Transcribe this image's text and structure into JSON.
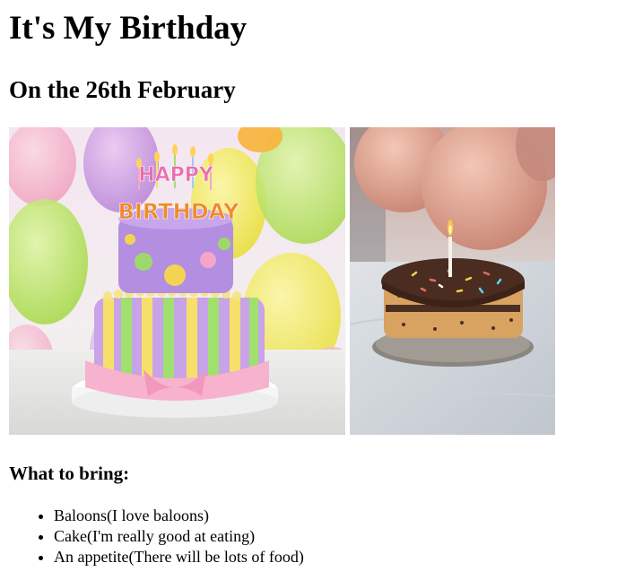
{
  "header": {
    "title": "It's My Birthday",
    "subtitle": "On the 26th February"
  },
  "photos": [
    {
      "label": "HAPPY",
      "label2": "BIRTHDAY",
      "icon": "birthday-cake-with-balloons-image"
    },
    {
      "icon": "chocolate-cake-with-candle-image"
    }
  ],
  "bring": {
    "heading": "What to bring:",
    "items": [
      "Baloons(I love baloons)",
      "Cake(I'm really good at eating)",
      "An appetite(There will be lots of food)"
    ]
  },
  "colors": {
    "text": "#000000",
    "background": "#ffffff"
  }
}
